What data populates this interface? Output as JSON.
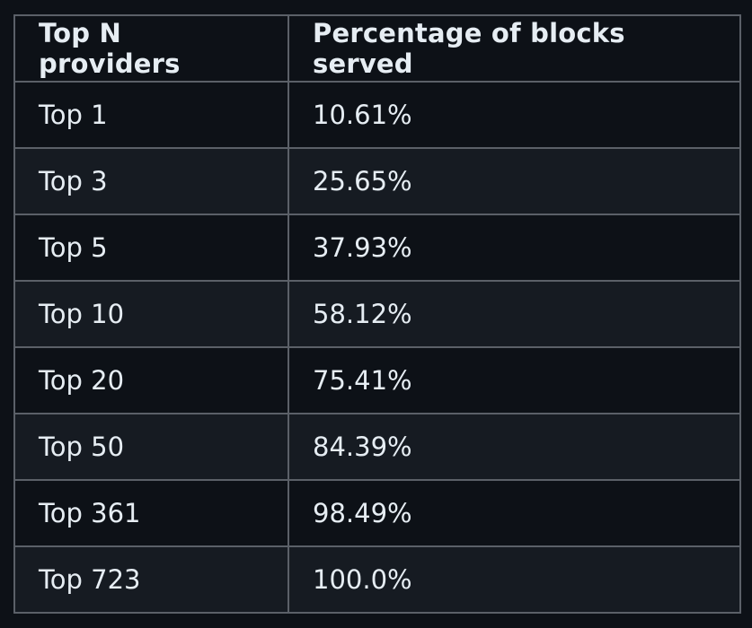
{
  "table": {
    "headers": [
      "Top N providers",
      "Percentage of blocks served"
    ],
    "rows": [
      [
        "Top 1",
        "10.61%"
      ],
      [
        "Top 3",
        "25.65%"
      ],
      [
        "Top 5",
        "37.93%"
      ],
      [
        "Top 10",
        "58.12%"
      ],
      [
        "Top 20",
        "75.41%"
      ],
      [
        "Top 50",
        "84.39%"
      ],
      [
        "Top 361",
        "98.49%"
      ],
      [
        "Top 723",
        "100.0%"
      ]
    ]
  },
  "colors": {
    "background": "#0d1117",
    "row_alt": "#161b22",
    "border": "#5b6068",
    "text": "#e6edf3"
  }
}
